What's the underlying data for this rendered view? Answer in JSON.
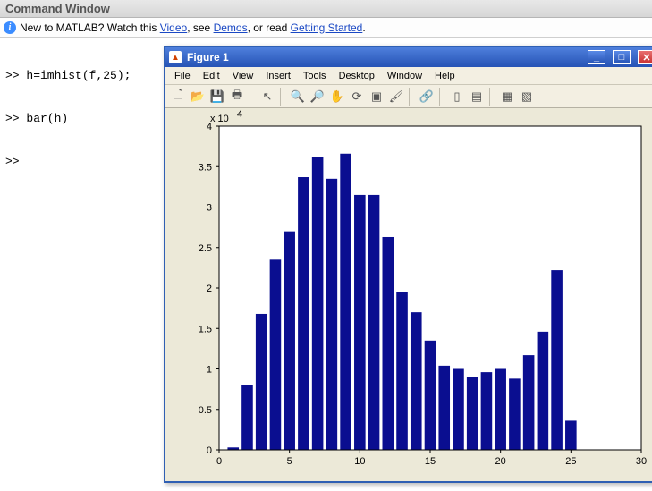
{
  "command_window": {
    "title": "Command Window",
    "info_prefix": "New to MATLAB? Watch this ",
    "info_link1": "Video",
    "info_mid1": ", see ",
    "info_link2": "Demos",
    "info_mid2": ", or read ",
    "info_link3": "Getting Started",
    "info_suffix": ".",
    "lines": [
      ">> h=imhist(f,25);",
      ">> bar(h)",
      ">> "
    ]
  },
  "figure": {
    "title": "Figure 1",
    "menu": [
      "File",
      "Edit",
      "View",
      "Insert",
      "Tools",
      "Desktop",
      "Window",
      "Help"
    ]
  },
  "chart_data": {
    "type": "bar",
    "categories": [
      1,
      2,
      3,
      4,
      5,
      6,
      7,
      8,
      9,
      10,
      11,
      12,
      13,
      14,
      15,
      16,
      17,
      18,
      19,
      20,
      21,
      22,
      23,
      24,
      25
    ],
    "values": [
      300,
      8000,
      16800,
      23500,
      27000,
      33700,
      36200,
      33500,
      36600,
      31500,
      31500,
      26300,
      19500,
      17000,
      13500,
      10400,
      10000,
      9000,
      9600,
      10000,
      8800,
      11700,
      14600,
      22200,
      3600
    ],
    "exponent_label": "x 10",
    "exponent_sup": "4",
    "xlim": [
      0,
      30
    ],
    "ylim": [
      0,
      40000
    ],
    "xticks": [
      0,
      5,
      10,
      15,
      20,
      25,
      30
    ],
    "yticks_major": [
      0,
      5000,
      10000,
      15000,
      20000,
      25000,
      30000,
      35000,
      40000
    ],
    "ytick_labels": [
      "0",
      "0.5",
      "1",
      "1.5",
      "2",
      "2.5",
      "3",
      "3.5",
      "4"
    ]
  }
}
